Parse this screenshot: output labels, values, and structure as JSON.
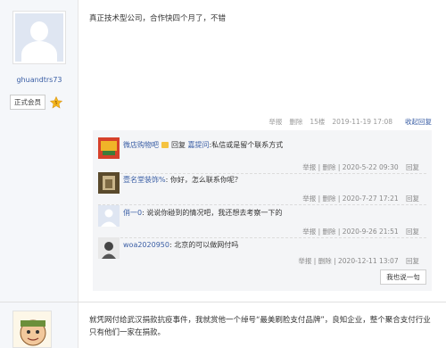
{
  "post1": {
    "username": "ghuandtrs73",
    "badge": "正式会员",
    "content": "真正技术型公司，合作快四个月了，不错",
    "meta": {
      "report": "举报",
      "delete": "删除",
      "floor": "15楼",
      "timestamp": "2019-11-19 17:08",
      "collapse_reply": "收起回复"
    },
    "comments": [
      {
        "name": "微店购物吧",
        "text_prefix": "回复",
        "reply_to": "嘉提问",
        "text": ":私信或是留个联系方式",
        "report": "举报",
        "delete": "删除",
        "timestamp": "2020-5-22 09:30",
        "reply": "回复"
      },
      {
        "name": "壹名堂装饰%",
        "text": "你好，怎么联系你呢？",
        "report": "举报",
        "delete": "删除",
        "timestamp": "2020-7-27 17:21",
        "reply": "回复"
      },
      {
        "name": "俏一0",
        "text": "说说你碰到的情况吧，我还想去考察一下的",
        "report": "举报",
        "delete": "删除",
        "timestamp": "2020-9-26 21:51",
        "reply": "回复"
      },
      {
        "name": "woa2020950",
        "text": "北京的可以做网付吗",
        "report": "举报",
        "delete": "删除",
        "timestamp": "2020-12-11 13:07",
        "reply": "回复"
      }
    ],
    "reply_button": "我也说一句"
  },
  "post2": {
    "content": "就凭网付给武汉捐款抗疫事件，我就赏他一个绰号“最美刷脸支付品牌”，良知企业，整个聚合支付行业只有他们一家在捐款。"
  },
  "colors": {
    "link": "#3a5ea5",
    "sidebar_bg": "#f5f7fa",
    "comments_bg": "#f4f5f7"
  }
}
